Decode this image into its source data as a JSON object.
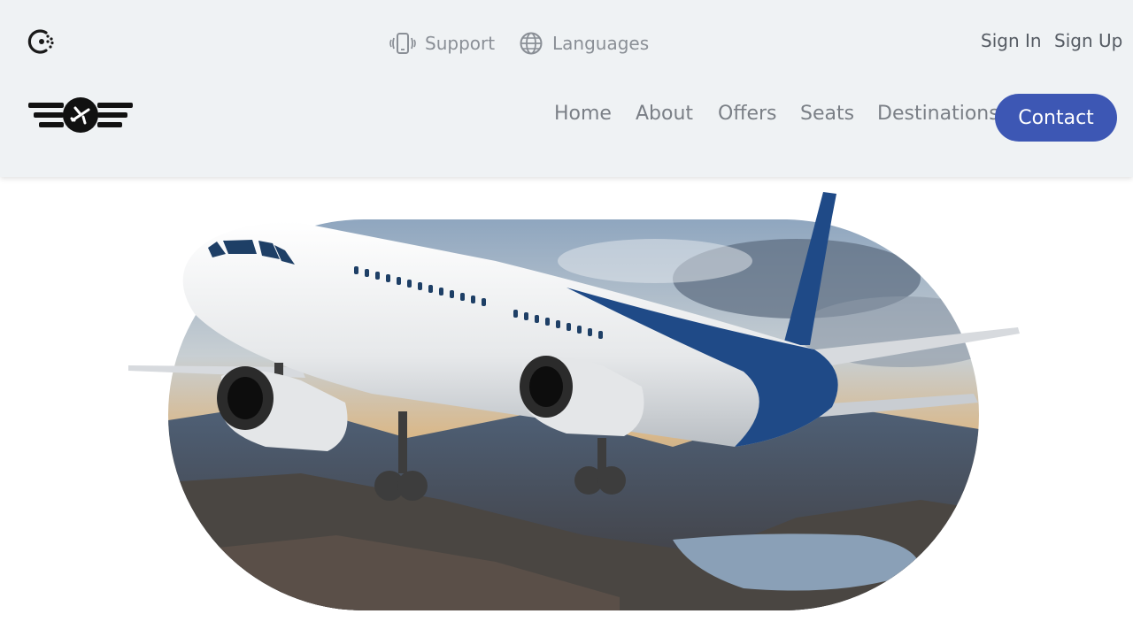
{
  "topbar": {
    "support_label": "Support",
    "languages_label": "Languages",
    "signin_label": "Sign In",
    "signup_label": "Sign Up"
  },
  "nav": {
    "items": [
      {
        "label": "Home"
      },
      {
        "label": "About"
      },
      {
        "label": "Offers"
      },
      {
        "label": "Seats"
      },
      {
        "label": "Destinations"
      }
    ],
    "contact_label": "Contact"
  },
  "hero": {
    "image_subject": "airplane flying over mountain lake landscape"
  },
  "icons": {
    "brand": "consul-style-brand-icon",
    "support": "phone-vibrate-icon",
    "languages": "globe-icon",
    "logo": "winged-airplane-logo"
  },
  "colors": {
    "header_bg": "#eff2f4",
    "accent": "#3d57b4",
    "plane_blue": "#1f4a87"
  }
}
